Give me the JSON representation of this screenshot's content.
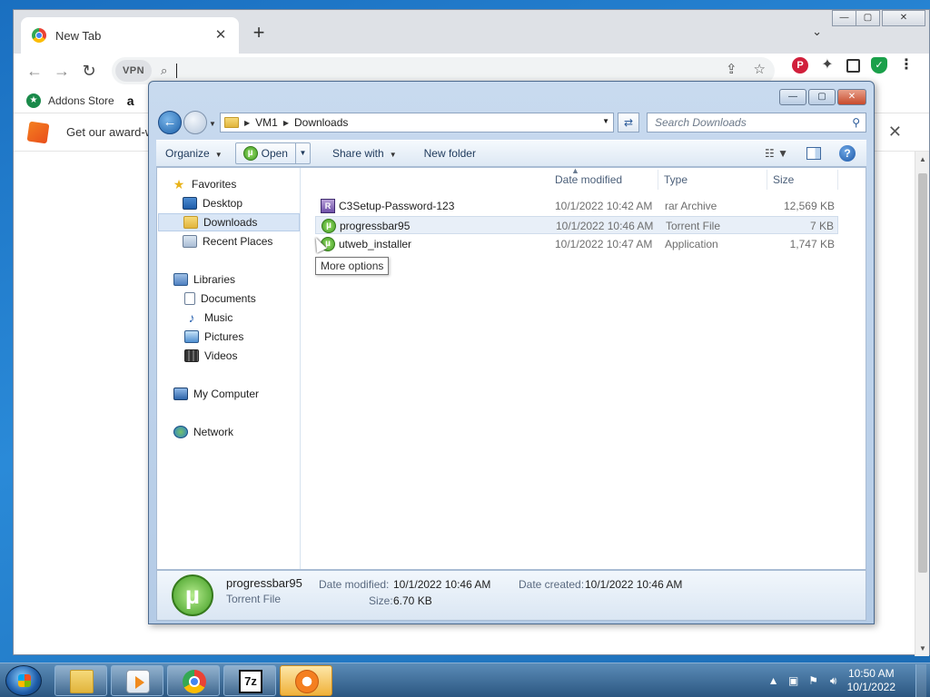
{
  "browser": {
    "tab_title": "New Tab",
    "tab_close": "✕",
    "new_tab": "+",
    "tab_search": "⌄",
    "win_min": "—",
    "win_max": "▢",
    "win_close": "✕",
    "vpn_label": "VPN",
    "omnibox_value": "",
    "bookmark_addons": "Addons Store",
    "bookmark_amazon": "a",
    "banner_text": "Get our award-w",
    "extension_p": "P"
  },
  "explorer": {
    "path": [
      "VM1",
      "Downloads"
    ],
    "search_placeholder": "Search Downloads",
    "toolbar": {
      "organize": "Organize",
      "open": "Open",
      "share_with": "Share with",
      "new_folder": "New folder"
    },
    "tooltip": "More options",
    "nav": {
      "favorites": "Favorites",
      "desktop": "Desktop",
      "downloads": "Downloads",
      "recent_places": "Recent Places",
      "libraries": "Libraries",
      "documents": "Documents",
      "music": "Music",
      "pictures": "Pictures",
      "videos": "Videos",
      "my_computer": "My Computer",
      "network": "Network"
    },
    "columns": {
      "date_modified": "Date modified",
      "type": "Type",
      "size": "Size"
    },
    "files": [
      {
        "name": "C3Setup-Password-123",
        "date": "10/1/2022 10:42 AM",
        "type": "rar Archive",
        "size": "12,569 KB",
        "icon": "rar-icon"
      },
      {
        "name": "progressbar95",
        "date": "10/1/2022 10:46 AM",
        "type": "Torrent File",
        "size": "7 KB",
        "icon": "utorrent-icon"
      },
      {
        "name": "utweb_installer",
        "date": "10/1/2022 10:47 AM",
        "type": "Application",
        "size": "1,747 KB",
        "icon": "utorrent-icon"
      }
    ],
    "details": {
      "name": "progressbar95",
      "type": "Torrent File",
      "date_modified_label": "Date modified:",
      "date_modified": "10/1/2022 10:46 AM",
      "date_created_label": "Date created:",
      "date_created": "10/1/2022 10:46 AM",
      "size_label": "Size:",
      "size": "6.70 KB"
    }
  },
  "taskbar": {
    "time": "10:50 AM",
    "date": "10/1/2022",
    "seven_zip": "7z"
  }
}
